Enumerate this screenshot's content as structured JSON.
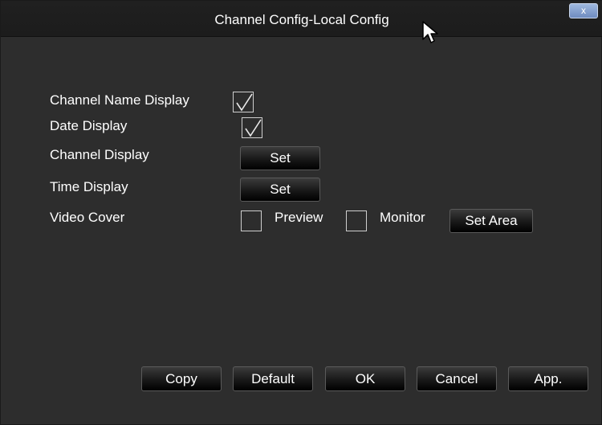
{
  "window": {
    "title": "Channel Config-Local Config",
    "close_label": "x"
  },
  "settings": {
    "channel_name_display": {
      "label": "Channel Name Display",
      "checked": true
    },
    "date_display": {
      "label": "Date Display",
      "checked": true
    },
    "channel_display": {
      "label": "Channel Display",
      "button": "Set"
    },
    "time_display": {
      "label": "Time Display",
      "button": "Set"
    },
    "video_cover": {
      "label": "Video Cover",
      "preview_label": "Preview",
      "preview_checked": false,
      "monitor_label": "Monitor",
      "monitor_checked": false,
      "set_area_button": "Set Area"
    }
  },
  "footer": {
    "copy": "Copy",
    "default": "Default",
    "ok": "OK",
    "cancel": "Cancel",
    "apply": "App."
  }
}
